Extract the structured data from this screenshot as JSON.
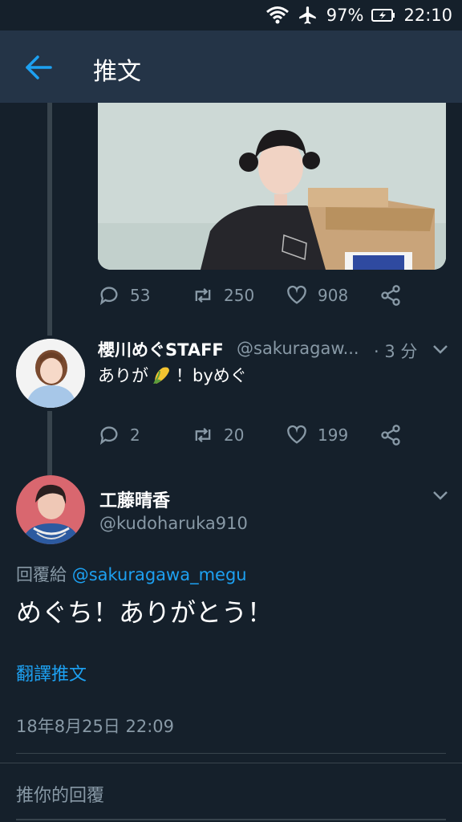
{
  "status_bar": {
    "battery": "97%",
    "time": "22:10",
    "icons": [
      "wifi-icon",
      "airplane-icon",
      "battery-charging-icon"
    ]
  },
  "app_bar": {
    "title": "推文",
    "back_icon": "arrow-left-icon"
  },
  "parent_tweet": {
    "image_desc": "photo",
    "replies": "53",
    "retweets": "250",
    "likes": "908"
  },
  "reply_tweet": {
    "name": "櫻川めぐSTAFF",
    "handle": "@sakuragaw...",
    "time": "· 3 分",
    "text_before": "ありが",
    "text_after": "！byめぐ",
    "replies": "2",
    "retweets": "20",
    "likes": "199"
  },
  "main_tweet": {
    "name": "工藤晴香",
    "handle": "@kudoharuka910",
    "replying_prefix": "回覆給",
    "replying_to": "@sakuragawa_megu",
    "text": "めぐち！ありがとう！",
    "translate": "翻譯推文",
    "timestamp": "18年8月25日 22:09"
  },
  "compose": {
    "placeholder": "推你的回覆"
  },
  "colors": {
    "background": "#15202b",
    "appbar": "#243447",
    "accent": "#1da1f2",
    "secondary_text": "#8899a6"
  }
}
